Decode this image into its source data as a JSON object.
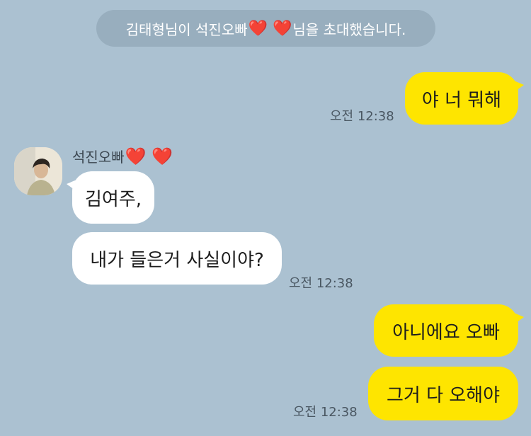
{
  "system_notice": {
    "prefix": "김태형님이 석진오빠",
    "hearts": "❤️ ❤️",
    "suffix": "님을 초대했습니다."
  },
  "messages": [
    {
      "text": "야 너 뭐해",
      "time": "오전 12:38"
    },
    {
      "sender_name": "석진오빠",
      "sender_hearts": "❤️ ❤️",
      "text": "김여주,"
    },
    {
      "text": "내가 들은거 사실이야?",
      "time": "오전 12:38"
    },
    {
      "text": "아니에요 오빠"
    },
    {
      "text": "그거 다 오해야",
      "time": "오전 12:38"
    }
  ],
  "colors": {
    "chat_background": "#abc1d1",
    "my_bubble": "#fee500",
    "their_bubble": "#ffffff",
    "notice_background": "#98aebe"
  },
  "icons": {
    "avatar": "profile-photo",
    "heart": "red-heart-emoji"
  }
}
